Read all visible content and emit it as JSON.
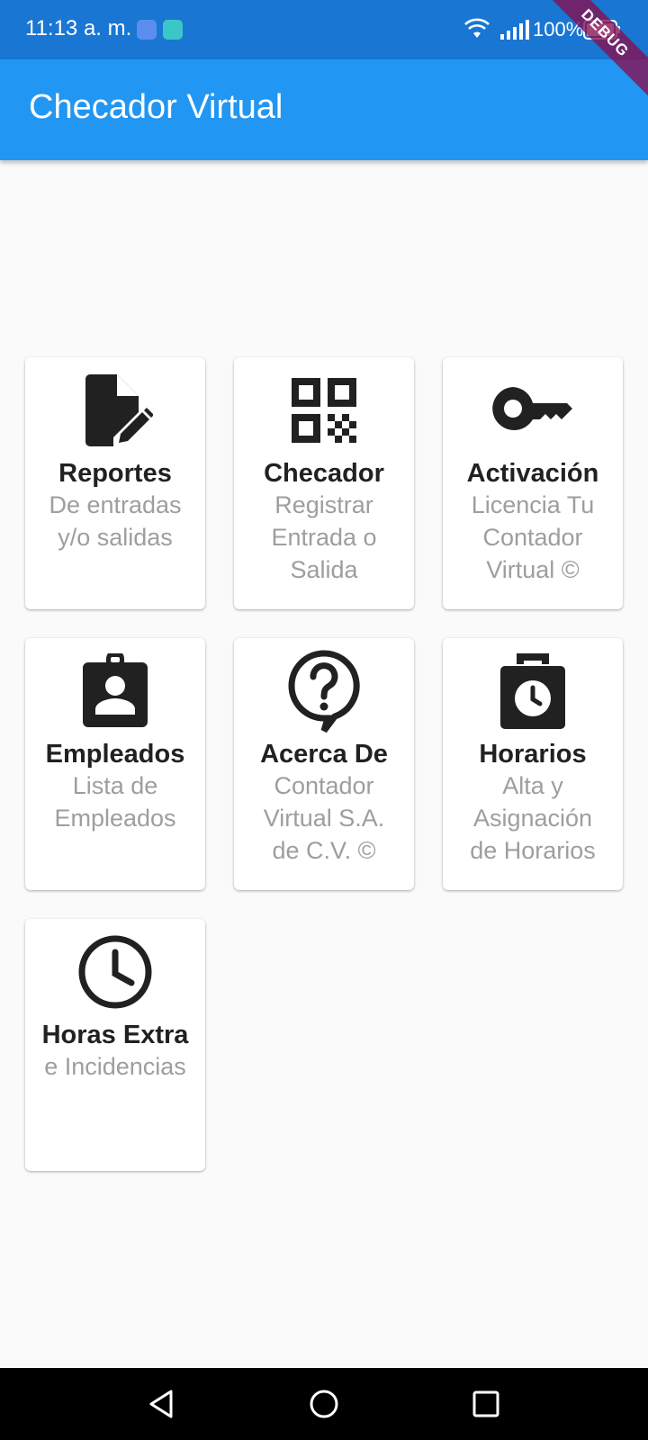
{
  "status_bar": {
    "time": "11:13 a. m.",
    "battery": "100%",
    "bg_color": "#1976d2"
  },
  "debug_banner": "DEBUG",
  "app_bar": {
    "title": "Checador Virtual",
    "bg_color": "#2196f3"
  },
  "menu": [
    {
      "icon": "edit-document-icon",
      "title": "Reportes",
      "subtitle": "De entradas\ny/o salidas"
    },
    {
      "icon": "qr-code-icon",
      "title": "Checador",
      "subtitle": "Registrar\nEntrada o\nSalida"
    },
    {
      "icon": "key-icon",
      "title": "Activación",
      "subtitle": "Licencia Tu\nContador\nVirtual ©"
    },
    {
      "icon": "badge-icon",
      "title": "Empleados",
      "subtitle": "Lista de\nEmpleados"
    },
    {
      "icon": "help-icon",
      "title": "Acerca De",
      "subtitle": "Contador\nVirtual S.A.\nde C.V. ©"
    },
    {
      "icon": "work-history-icon",
      "title": "Horarios",
      "subtitle": "Alta y\nAsignación\nde Horarios"
    },
    {
      "icon": "clock-icon",
      "title": "Horas Extra",
      "subtitle": "e Incidencias"
    }
  ],
  "nav_bar": {
    "back": "back-icon",
    "home": "home-icon",
    "recent": "recent-apps-icon"
  }
}
